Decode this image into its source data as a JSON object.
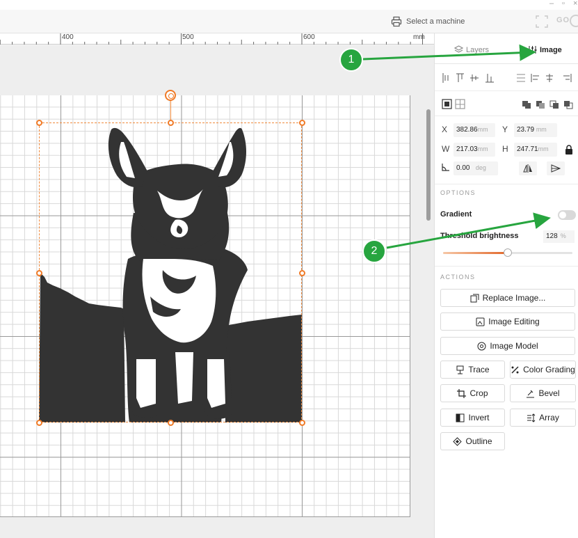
{
  "topbar": {
    "select_machine_label": "Select a machine",
    "go_label": "GO"
  },
  "ruler": {
    "labels": [
      "400",
      "500",
      "600"
    ],
    "unit": "mm"
  },
  "panel": {
    "tabs": {
      "layers": "Layers",
      "image": "Image"
    },
    "transform": {
      "x_label": "X",
      "x_value": "382.86",
      "x_unit": "mm",
      "y_label": "Y",
      "y_value": "23.79",
      "y_unit": "mm",
      "w_label": "W",
      "w_value": "217.03",
      "w_unit": "mm",
      "h_label": "H",
      "h_value": "247.71",
      "h_unit": "mm",
      "rotation_value": "0.00",
      "rotation_unit": "deg"
    },
    "options": {
      "section_title": "OPTIONS",
      "gradient_label": "Gradient",
      "gradient_on": false,
      "threshold_label": "Threshold brightness",
      "threshold_value": "128",
      "threshold_unit": "%",
      "threshold_fraction": 0.5
    },
    "actions": {
      "section_title": "ACTIONS",
      "replace_image": "Replace Image...",
      "image_editing": "Image Editing",
      "image_model": "Image Model",
      "trace": "Trace",
      "color_grading": "Color Grading",
      "crop": "Crop",
      "bevel": "Bevel",
      "invert": "Invert",
      "array": "Array",
      "outline": "Outline"
    }
  },
  "annotations": {
    "badge_1": "1",
    "badge_2": "2",
    "color": "#27a53f"
  },
  "colors": {
    "selection": "#f07a26",
    "image_fill": "#333333"
  }
}
